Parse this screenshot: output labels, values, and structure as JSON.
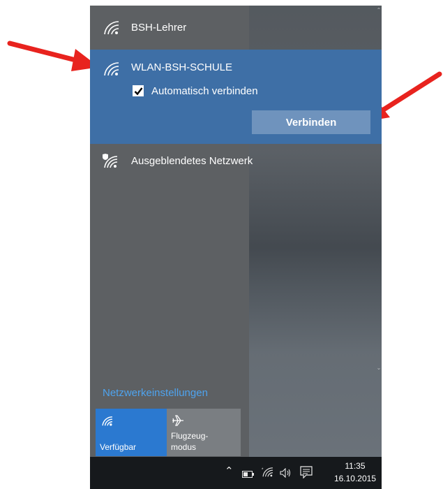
{
  "networks": [
    {
      "name": "BSH-Lehrer"
    },
    {
      "name": "WLAN-BSH-SCHULE",
      "auto_connect_label": "Automatisch verbinden",
      "auto_connect_checked": true,
      "connect_label": "Verbinden"
    },
    {
      "name": "Ausgeblendetes Netzwerk"
    }
  ],
  "settings_link": "Netzwerkeinstellungen",
  "tiles": {
    "wifi_label": "Verfügbar",
    "airplane_label_line1": "Flugzeug-",
    "airplane_label_line2": "modus"
  },
  "taskbar": {
    "time": "11:35",
    "date": "16.10.2015"
  },
  "colors": {
    "selected_network": "#3e6fa6",
    "link": "#4ea3ee",
    "wifi_tile": "#2b79d0",
    "arrow": "#e8231e"
  },
  "icons": [
    "wifi-icon",
    "checkbox-checked-icon",
    "shield-wifi-icon",
    "airplane-icon",
    "chevron-up-icon",
    "battery-icon",
    "speaker-icon",
    "action-center-icon"
  ]
}
